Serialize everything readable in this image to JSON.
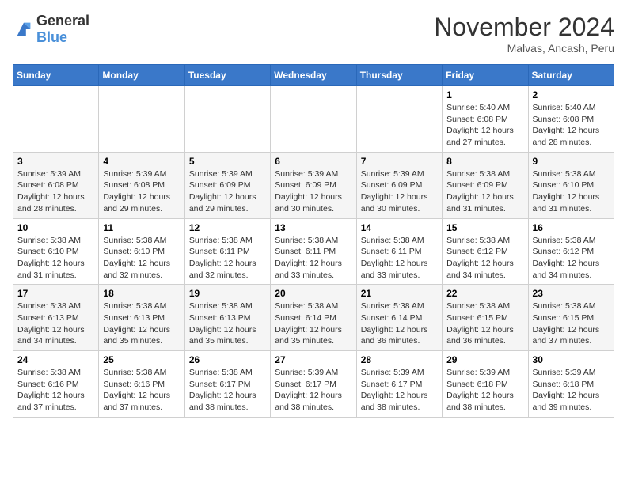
{
  "header": {
    "logo_general": "General",
    "logo_blue": "Blue",
    "title": "November 2024",
    "location": "Malvas, Ancash, Peru"
  },
  "weekdays": [
    "Sunday",
    "Monday",
    "Tuesday",
    "Wednesday",
    "Thursday",
    "Friday",
    "Saturday"
  ],
  "weeks": [
    [
      {
        "day": "",
        "info": ""
      },
      {
        "day": "",
        "info": ""
      },
      {
        "day": "",
        "info": ""
      },
      {
        "day": "",
        "info": ""
      },
      {
        "day": "",
        "info": ""
      },
      {
        "day": "1",
        "info": "Sunrise: 5:40 AM\nSunset: 6:08 PM\nDaylight: 12 hours and 27 minutes."
      },
      {
        "day": "2",
        "info": "Sunrise: 5:40 AM\nSunset: 6:08 PM\nDaylight: 12 hours and 28 minutes."
      }
    ],
    [
      {
        "day": "3",
        "info": "Sunrise: 5:39 AM\nSunset: 6:08 PM\nDaylight: 12 hours and 28 minutes."
      },
      {
        "day": "4",
        "info": "Sunrise: 5:39 AM\nSunset: 6:08 PM\nDaylight: 12 hours and 29 minutes."
      },
      {
        "day": "5",
        "info": "Sunrise: 5:39 AM\nSunset: 6:09 PM\nDaylight: 12 hours and 29 minutes."
      },
      {
        "day": "6",
        "info": "Sunrise: 5:39 AM\nSunset: 6:09 PM\nDaylight: 12 hours and 30 minutes."
      },
      {
        "day": "7",
        "info": "Sunrise: 5:39 AM\nSunset: 6:09 PM\nDaylight: 12 hours and 30 minutes."
      },
      {
        "day": "8",
        "info": "Sunrise: 5:38 AM\nSunset: 6:09 PM\nDaylight: 12 hours and 31 minutes."
      },
      {
        "day": "9",
        "info": "Sunrise: 5:38 AM\nSunset: 6:10 PM\nDaylight: 12 hours and 31 minutes."
      }
    ],
    [
      {
        "day": "10",
        "info": "Sunrise: 5:38 AM\nSunset: 6:10 PM\nDaylight: 12 hours and 31 minutes."
      },
      {
        "day": "11",
        "info": "Sunrise: 5:38 AM\nSunset: 6:10 PM\nDaylight: 12 hours and 32 minutes."
      },
      {
        "day": "12",
        "info": "Sunrise: 5:38 AM\nSunset: 6:11 PM\nDaylight: 12 hours and 32 minutes."
      },
      {
        "day": "13",
        "info": "Sunrise: 5:38 AM\nSunset: 6:11 PM\nDaylight: 12 hours and 33 minutes."
      },
      {
        "day": "14",
        "info": "Sunrise: 5:38 AM\nSunset: 6:11 PM\nDaylight: 12 hours and 33 minutes."
      },
      {
        "day": "15",
        "info": "Sunrise: 5:38 AM\nSunset: 6:12 PM\nDaylight: 12 hours and 34 minutes."
      },
      {
        "day": "16",
        "info": "Sunrise: 5:38 AM\nSunset: 6:12 PM\nDaylight: 12 hours and 34 minutes."
      }
    ],
    [
      {
        "day": "17",
        "info": "Sunrise: 5:38 AM\nSunset: 6:13 PM\nDaylight: 12 hours and 34 minutes."
      },
      {
        "day": "18",
        "info": "Sunrise: 5:38 AM\nSunset: 6:13 PM\nDaylight: 12 hours and 35 minutes."
      },
      {
        "day": "19",
        "info": "Sunrise: 5:38 AM\nSunset: 6:13 PM\nDaylight: 12 hours and 35 minutes."
      },
      {
        "day": "20",
        "info": "Sunrise: 5:38 AM\nSunset: 6:14 PM\nDaylight: 12 hours and 35 minutes."
      },
      {
        "day": "21",
        "info": "Sunrise: 5:38 AM\nSunset: 6:14 PM\nDaylight: 12 hours and 36 minutes."
      },
      {
        "day": "22",
        "info": "Sunrise: 5:38 AM\nSunset: 6:15 PM\nDaylight: 12 hours and 36 minutes."
      },
      {
        "day": "23",
        "info": "Sunrise: 5:38 AM\nSunset: 6:15 PM\nDaylight: 12 hours and 37 minutes."
      }
    ],
    [
      {
        "day": "24",
        "info": "Sunrise: 5:38 AM\nSunset: 6:16 PM\nDaylight: 12 hours and 37 minutes."
      },
      {
        "day": "25",
        "info": "Sunrise: 5:38 AM\nSunset: 6:16 PM\nDaylight: 12 hours and 37 minutes."
      },
      {
        "day": "26",
        "info": "Sunrise: 5:38 AM\nSunset: 6:17 PM\nDaylight: 12 hours and 38 minutes."
      },
      {
        "day": "27",
        "info": "Sunrise: 5:39 AM\nSunset: 6:17 PM\nDaylight: 12 hours and 38 minutes."
      },
      {
        "day": "28",
        "info": "Sunrise: 5:39 AM\nSunset: 6:17 PM\nDaylight: 12 hours and 38 minutes."
      },
      {
        "day": "29",
        "info": "Sunrise: 5:39 AM\nSunset: 6:18 PM\nDaylight: 12 hours and 38 minutes."
      },
      {
        "day": "30",
        "info": "Sunrise: 5:39 AM\nSunset: 6:18 PM\nDaylight: 12 hours and 39 minutes."
      }
    ]
  ]
}
